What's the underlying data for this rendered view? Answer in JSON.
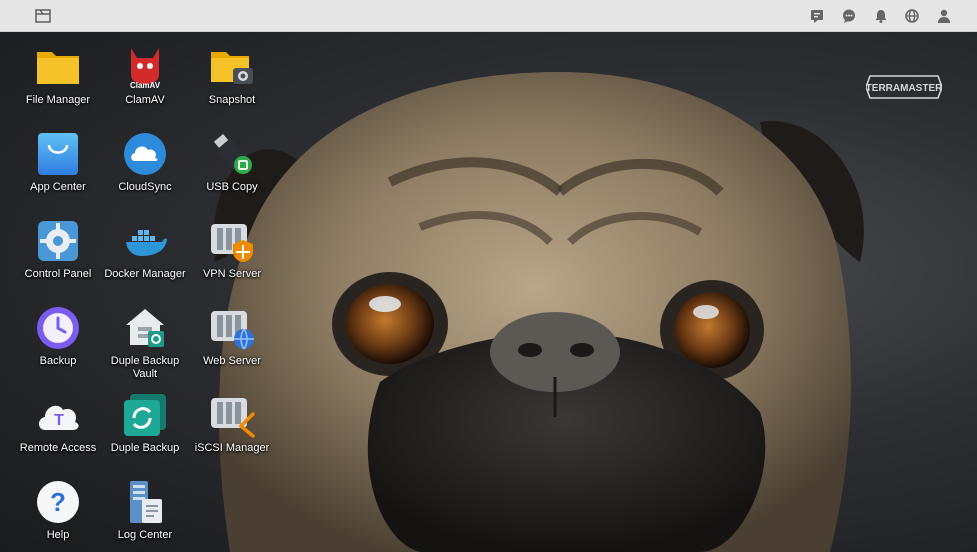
{
  "topbar": {
    "left_icon": "window-icon",
    "right_icons": [
      "message-icon",
      "chat-icon",
      "bell-icon",
      "globe-icon",
      "user-icon"
    ]
  },
  "brand": {
    "logo_text": "TERRAMASTER"
  },
  "desktop_apps": [
    {
      "id": "file-manager",
      "label": "File Manager"
    },
    {
      "id": "clamav",
      "label": "ClamAV",
      "icon_text": "ClamAV"
    },
    {
      "id": "snapshot",
      "label": "Snapshot"
    },
    {
      "id": "app-center",
      "label": "App Center"
    },
    {
      "id": "cloudsync",
      "label": "CloudSync"
    },
    {
      "id": "usb-copy",
      "label": "USB Copy"
    },
    {
      "id": "control-panel",
      "label": "Control Panel"
    },
    {
      "id": "docker-manager",
      "label": "Docker Manager"
    },
    {
      "id": "vpn-server",
      "label": "VPN Server"
    },
    {
      "id": "backup",
      "label": "Backup"
    },
    {
      "id": "duple-backup-vault",
      "label": "Duple Backup Vault"
    },
    {
      "id": "web-server",
      "label": "Web Server"
    },
    {
      "id": "remote-access",
      "label": "Remote Access",
      "icon_text": "T"
    },
    {
      "id": "duple-backup",
      "label": "Duple Backup"
    },
    {
      "id": "iscsi-manager",
      "label": "iSCSI Manager"
    },
    {
      "id": "help",
      "label": "Help",
      "icon_text": "?"
    },
    {
      "id": "log-center",
      "label": "Log Center"
    }
  ],
  "colors": {
    "topbar": "#e6e6e6",
    "folder": "#f4c430",
    "accent_blue": "#2e8bdc",
    "vpn_orange": "#f08a00"
  }
}
